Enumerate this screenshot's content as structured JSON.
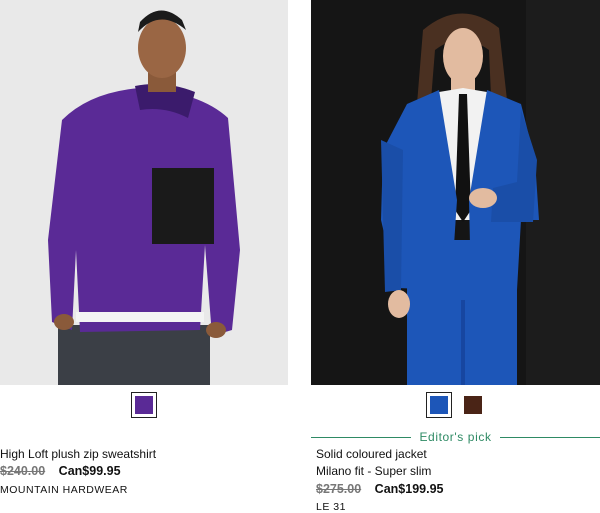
{
  "products": [
    {
      "name": "High Loft plush zip sweatshirt",
      "price_original": "$240.00",
      "price_sale": "Can$99.95",
      "brand": "MOUNTAIN HARDWEAR",
      "swatches": [
        {
          "color": "#5a2a96",
          "selected": true
        }
      ]
    },
    {
      "badge": "Editor's pick",
      "name": "Solid coloured jacket",
      "fit": "Milano fit - Super slim",
      "price_original": "$275.00",
      "price_sale": "Can$199.95",
      "brand": "LE 31",
      "swatches": [
        {
          "color": "#1d56b8",
          "selected": true
        },
        {
          "color": "#4a2416",
          "selected": false
        }
      ]
    }
  ],
  "colors": {
    "accent_green": "#2e8a64",
    "strike_grey": "#777777"
  }
}
